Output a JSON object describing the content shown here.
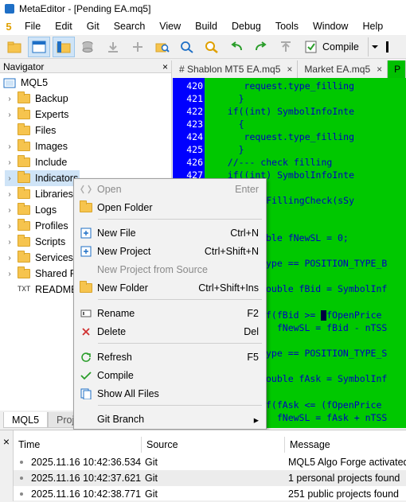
{
  "window": {
    "title": "MetaEditor - [Pending EA.mq5]"
  },
  "menu": {
    "logo": "5",
    "items": [
      "File",
      "Edit",
      "Git",
      "Search",
      "View",
      "Build",
      "Debug",
      "Tools",
      "Window",
      "Help"
    ]
  },
  "toolbar": {
    "compile_label": "Compile"
  },
  "navigator": {
    "title": "Navigator",
    "close": "×",
    "root": "MQL5",
    "items": [
      "Backup",
      "Experts",
      "Files",
      "Images",
      "Include",
      "Indicators",
      "Libraries",
      "Logs",
      "Profiles",
      "Scripts",
      "Services",
      "Shared Projects",
      "README"
    ],
    "readme_icon": "TXT",
    "tabs": [
      "MQL5",
      "Project"
    ]
  },
  "editor": {
    "tabs": [
      {
        "label": "# Shablon MT5 EA.mq5",
        "close": "×"
      },
      {
        "label": "Market EA.mq5",
        "close": "×"
      },
      {
        "label": "P",
        "close": ""
      }
    ],
    "line_numbers": [
      "420",
      "421",
      "422",
      "423",
      "424",
      "425",
      "426",
      "427"
    ],
    "code_lines": [
      "      request.type_filling",
      "     }",
      "   if((int) SymbolInfoInte",
      "     {",
      "      request.type_filling",
      "     }",
      "   //--- check filling",
      "   if((int) SymbolInfoInte",
      "     {",
      "      if(!FillingCheck(sSy",
      "     }",
      "",
      "ble fNewSL = 0;",
      "",
      "ype == POSITION_TYPE_B",
      "",
      "ouble fBid = SymbolInf",
      "",
      "f(fBid >= ",
      "fOpenPrice",
      "  fNewSL = fBid - nTSS",
      "",
      "ype == POSITION_TYPE_S",
      "",
      "ouble fAsk = SymbolInf",
      "",
      "f(fAsk <= (fOpenPrice",
      "  fNewSL = fAsk + nTSS"
    ]
  },
  "context_menu": {
    "items": [
      {
        "label": "Open",
        "shortcut": "Enter",
        "icon": "open-icon",
        "disabled": true
      },
      {
        "label": "Open Folder",
        "shortcut": "",
        "icon": "folder-icon"
      },
      {
        "label": "New File",
        "shortcut": "Ctrl+N",
        "icon": "new-file-icon"
      },
      {
        "label": "New Project",
        "shortcut": "Ctrl+Shift+N",
        "icon": "new-project-icon"
      },
      {
        "label": "New Project from Source",
        "shortcut": "",
        "icon": "",
        "disabled": true
      },
      {
        "label": "New Folder",
        "shortcut": "Ctrl+Shift+Ins",
        "icon": "new-folder-icon"
      },
      {
        "label": "Rename",
        "shortcut": "F2",
        "icon": "rename-icon"
      },
      {
        "label": "Delete",
        "shortcut": "Del",
        "icon": "delete-icon"
      },
      {
        "label": "Refresh",
        "shortcut": "F5",
        "icon": "refresh-icon"
      },
      {
        "label": "Compile",
        "shortcut": "",
        "icon": "check-icon"
      },
      {
        "label": "Show All Files",
        "shortcut": "",
        "icon": "show-files-icon"
      },
      {
        "label": "Git Branch",
        "shortcut": "",
        "icon": ""
      }
    ],
    "submenu_arrow": "▸"
  },
  "log": {
    "close": "×",
    "columns": [
      "Time",
      "Source",
      "Message"
    ],
    "rows": [
      {
        "time": "2025.11.16 10:42:36.534",
        "source": "Git",
        "message": "MQL5 Algo Forge activated"
      },
      {
        "time": "2025.11.16 10:42:37.621",
        "source": "Git",
        "message": "1 personal projects found"
      },
      {
        "time": "2025.11.16 10:42:38.771",
        "source": "Git",
        "message": "251 public projects found"
      }
    ]
  },
  "colors": {
    "editor_bg": "#00c800",
    "gutter_bg": "#0000ff",
    "code_text": "#0000c0",
    "active_tab": "#00c000"
  }
}
